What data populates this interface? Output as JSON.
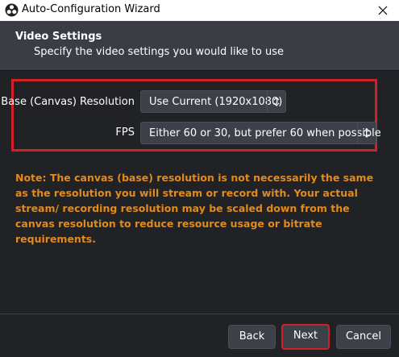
{
  "window": {
    "title": "Auto-Configuration Wizard",
    "logo_icon": "obs-logo-icon",
    "close_icon": "close-icon"
  },
  "header": {
    "title": "Video Settings",
    "subtitle": "Specify the video settings you would like to use"
  },
  "form": {
    "resolution_label": "Base (Canvas) Resolution",
    "resolution_value": "Use Current (1920x1080)",
    "fps_label": "FPS",
    "fps_value": "Either 60 or 30, but prefer 60 when possible",
    "spinner_icon": "up-down-chevron-icon"
  },
  "note": "Note: The canvas (base) resolution is not necessarily the same as the resolution you will stream or record with. Your actual stream/ recording resolution may be scaled down from the canvas resolution to reduce resource usage or bitrate requirements.",
  "footer": {
    "back_label": "Back",
    "next_label": "Next",
    "cancel_label": "Cancel"
  },
  "colors": {
    "highlight": "#d31f27",
    "note_text": "#e38a1d",
    "background": "#202225",
    "header_background": "#3a3d44",
    "control_background": "#3c4049"
  }
}
